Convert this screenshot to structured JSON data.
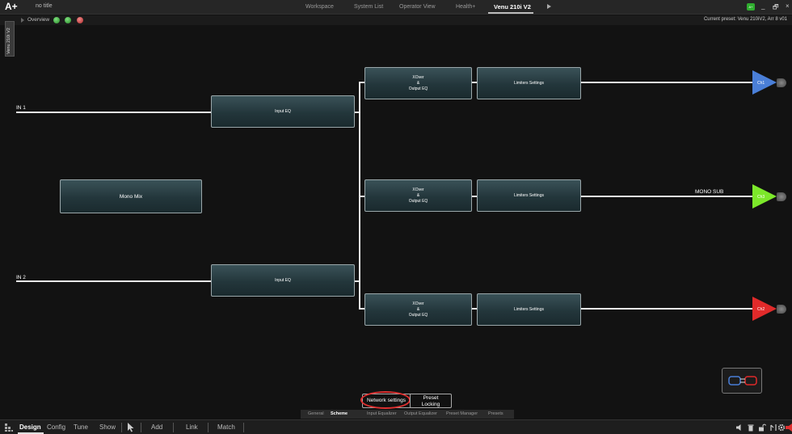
{
  "titlebar": {
    "logo": "A+",
    "doc_title": "no title",
    "tabs": [
      {
        "label": "Workspace"
      },
      {
        "label": "System List"
      },
      {
        "label": "Operator View"
      },
      {
        "label": "Health+"
      },
      {
        "label": "Venu 210i V2"
      }
    ],
    "user_badge": "A+",
    "minimize": "_",
    "restore": "🗗",
    "close": "×"
  },
  "subbar": {
    "overview_label": "Overview",
    "current_preset": "Current preset: Venu 210iV2, Arr 8 v01"
  },
  "device_tab": "Venu 210i V2",
  "scheme": {
    "in1": "IN 1",
    "in2": "IN 2",
    "input_eq_1": "Input EQ",
    "input_eq_2": "Input EQ",
    "mono_mix": "Mono Mix",
    "xover_1": [
      "XOver",
      "&",
      "Output EQ"
    ],
    "xover_2": [
      "XOver",
      "&",
      "Output EQ"
    ],
    "xover_3": [
      "XOver",
      "&",
      "Output EQ"
    ],
    "limiters_1": "Limiters Settings",
    "limiters_2": "Limiters Settings",
    "limiters_3": "Limiters Settings",
    "mono_sub": "MONO SUB",
    "ch1": "Ch1",
    "ch2": "Ch2",
    "ch3": "Ch3",
    "colors": {
      "ch1": "#4a7fd8",
      "ch2": "#e02a2a",
      "ch3": "#7ce82a"
    }
  },
  "buttons": {
    "network_settings": "Network settings",
    "preset_locking_1": "Preset",
    "preset_locking_2": "Locking"
  },
  "device_subtabs": [
    {
      "label": "General"
    },
    {
      "label": "Scheme"
    },
    {
      "label": "Input Equalizer"
    },
    {
      "label": "Output Equalizer"
    },
    {
      "label": "Preset Manager"
    },
    {
      "label": "Presets"
    }
  ],
  "modebar": {
    "modes": [
      {
        "label": "Design"
      },
      {
        "label": "Config"
      },
      {
        "label": "Tune"
      },
      {
        "label": "Show"
      }
    ],
    "tools": [
      {
        "label": "Add"
      },
      {
        "label": "Link"
      },
      {
        "label": "Match"
      }
    ]
  }
}
